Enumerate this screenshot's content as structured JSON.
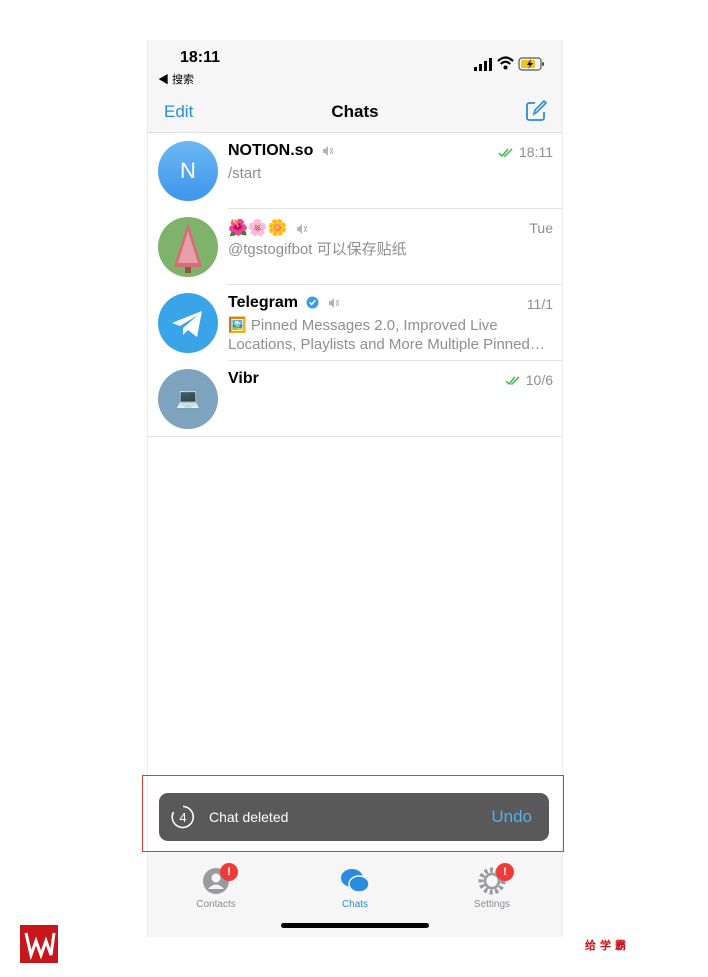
{
  "status": {
    "time": "18:11",
    "back_app": "◀ 搜索"
  },
  "nav": {
    "edit_label": "Edit",
    "title": "Chats"
  },
  "chats": [
    {
      "name": "NOTION.so",
      "time": "18:11",
      "message": "/start",
      "read": true,
      "muted": true,
      "avatar_letter": "N"
    },
    {
      "name": "🌺🌸🌼",
      "time": "Tue",
      "message": "@tgstogifbot 可以保存贴纸",
      "muted": true
    },
    {
      "name": "Telegram",
      "time": "11/1",
      "message": "🖼️ Pinned Messages 2.0, Improved Live Locations, Playlists and More Multiple Pinned…",
      "verified": true,
      "muted": true
    },
    {
      "name": "Vibr",
      "time": "10/6",
      "message": "",
      "read": true,
      "avatar_emoji": "💻"
    }
  ],
  "toast": {
    "countdown": "4",
    "text": "Chat deleted",
    "action": "Undo"
  },
  "tabs": [
    {
      "label": "Contacts",
      "badge": "!"
    },
    {
      "label": "Chats",
      "active": true
    },
    {
      "label": "Settings",
      "badge": "!"
    }
  ],
  "watermark": {
    "brand": "给学霸"
  },
  "colors": {
    "accent": "#2a8cde",
    "badge": "#ef3a3a",
    "toast_bg": "#595959",
    "highlight": "#e03a3a",
    "check": "#3dbb4a"
  }
}
